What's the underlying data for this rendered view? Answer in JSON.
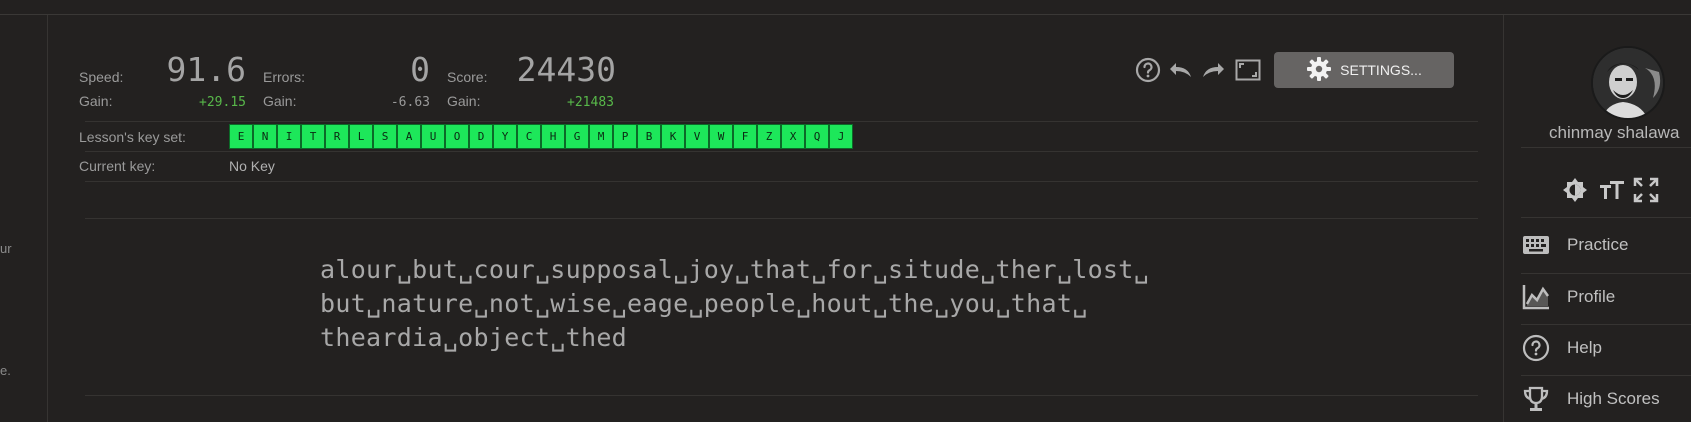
{
  "stats": {
    "speed": {
      "label": "Speed:",
      "value": "91.6",
      "gain_label": "Gain:",
      "gain": "+29.15"
    },
    "errors": {
      "label": "Errors:",
      "value": "0",
      "gain_label": "Gain:",
      "gain": "-6.63"
    },
    "score": {
      "label": "Score:",
      "value": "24430",
      "gain_label": "Gain:",
      "gain": "+21483"
    }
  },
  "lesson": {
    "keyset_label": "Lesson's key set:",
    "keys": [
      "E",
      "N",
      "I",
      "T",
      "R",
      "L",
      "S",
      "A",
      "U",
      "O",
      "D",
      "Y",
      "C",
      "H",
      "G",
      "M",
      "P",
      "B",
      "K",
      "V",
      "W",
      "F",
      "Z",
      "X",
      "Q",
      "J"
    ],
    "current_key_label": "Current key:",
    "current_key": "No Key"
  },
  "toolbar": {
    "help_icon": "help-circle-icon",
    "undo_icon": "undo-icon",
    "redo_icon": "redo-icon",
    "fullscreen_icon": "fullscreen-icon",
    "settings_label": "SETTINGS..."
  },
  "text": {
    "lines": [
      "alour␣but␣cour␣supposal␣joy␣that␣for␣situde␣ther␣lost␣",
      "but␣nature␣not␣wise␣eage␣people␣hout␣the␣you␣that␣",
      "theardia␣object␣thed"
    ]
  },
  "left_fragments": [
    "ur",
    "e."
  ],
  "sidebar": {
    "user_name": "chinmay shalawa",
    "icons": [
      "theme-icon",
      "font-size-icon",
      "expand-icon"
    ],
    "nav": [
      {
        "label": "Practice",
        "icon": "keyboard-icon"
      },
      {
        "label": "Profile",
        "icon": "chart-icon"
      },
      {
        "label": "Help",
        "icon": "help-circle-icon"
      },
      {
        "label": "High Scores",
        "icon": "trophy-icon"
      }
    ]
  },
  "colors": {
    "background": "#232120",
    "key_active": "#1de75a",
    "gain_positive": "#58b84a",
    "settings_button": "#666463"
  }
}
